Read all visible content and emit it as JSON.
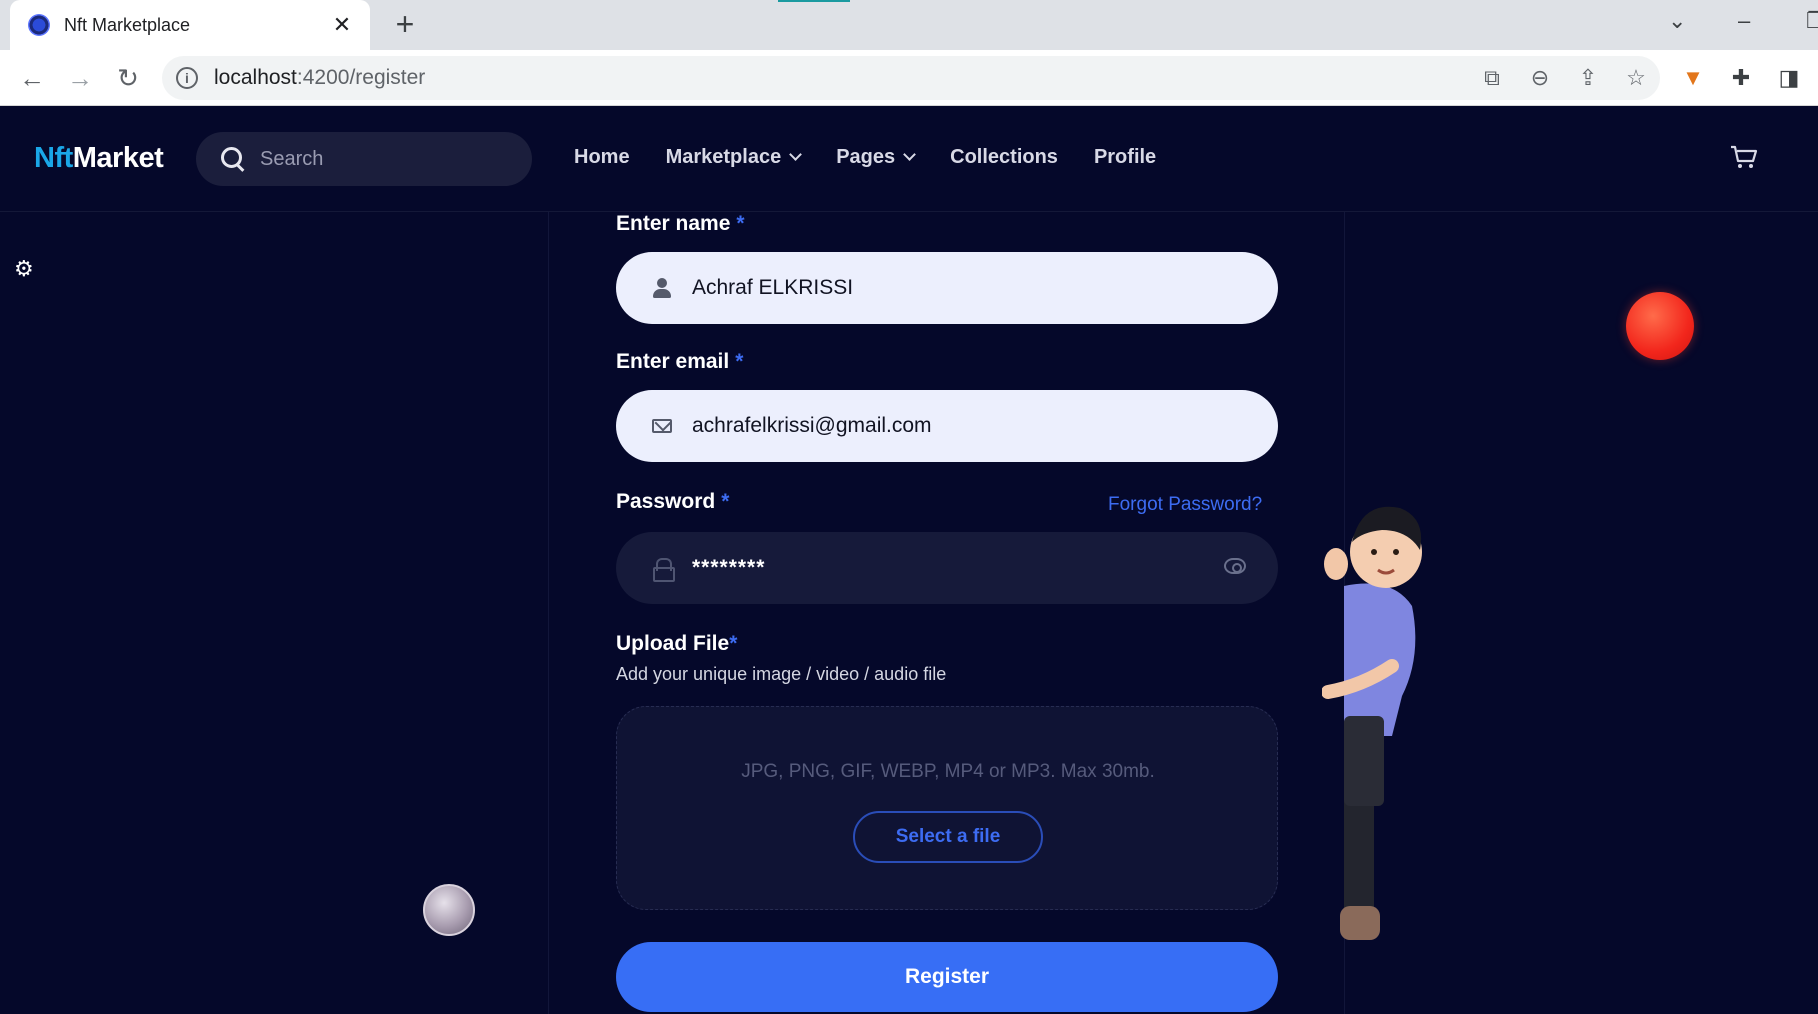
{
  "browser": {
    "tab_title": "Nft Marketplace",
    "tab_close": "✕",
    "new_tab": "+",
    "url_host": "localhost",
    "url_rest": ":4200/register"
  },
  "nav": {
    "logo_a": "Nft",
    "logo_b": "Market",
    "search_placeholder": "Search",
    "items": [
      {
        "label": "Home"
      },
      {
        "label": "Marketplace"
      },
      {
        "label": "Pages"
      },
      {
        "label": "Collections"
      },
      {
        "label": "Profile"
      }
    ]
  },
  "form": {
    "name_label": "Enter name",
    "name_value": "Achraf ELKRISSI",
    "email_label": "Enter email",
    "email_value": "achrafelkrissi@gmail.com",
    "password_label": "Password",
    "password_value": "********",
    "forgot": "Forgot Password?",
    "required_mark": "*",
    "upload_label": "Upload File",
    "upload_sub": "Add your unique image / video / audio file",
    "formats": "JPG, PNG, GIF, WEBP, MP4 or MP3. Max 30mb.",
    "select_button": "Select a file",
    "register_button": "Register"
  },
  "colors": {
    "accent": "#376ef5",
    "page_bg": "#05082a",
    "logo_accent": "#1aa7e8"
  }
}
